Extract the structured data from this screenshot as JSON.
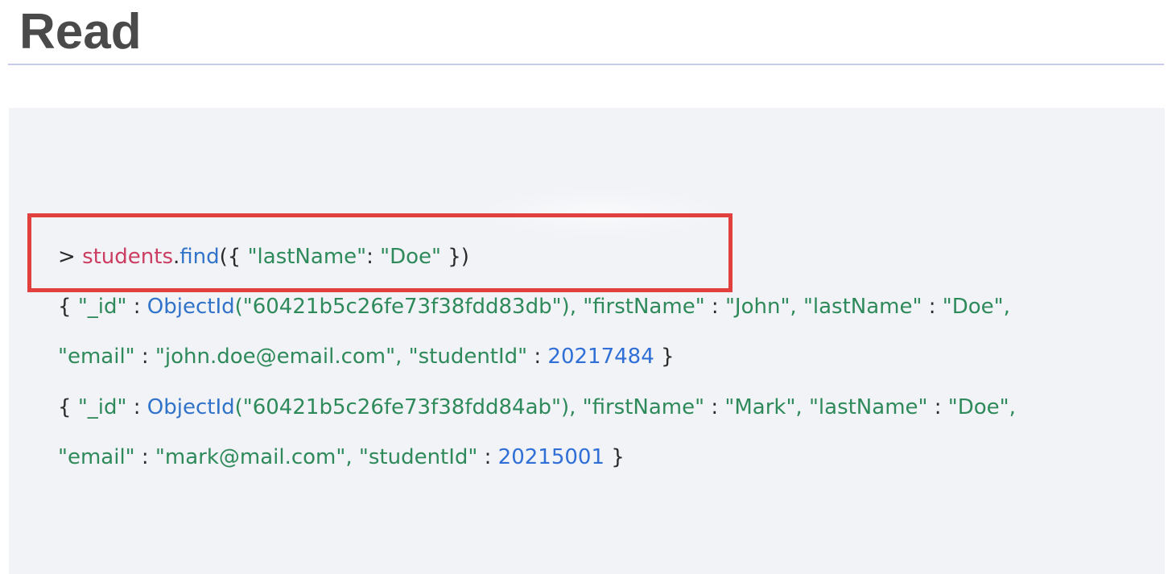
{
  "slide": {
    "title": "Read"
  },
  "command": {
    "prompt": ">",
    "collection": "students",
    "dot": ".",
    "method": "find",
    "open": "({",
    "key": "\"lastName\"",
    "colon": ":",
    "value": "\"Doe\"",
    "close": "})"
  },
  "results": [
    {
      "open": "{",
      "id_key": "\"_id\"",
      "sep": ":",
      "objectid_fn": "ObjectId",
      "objectid_arg": "(\"60421b5c26fe73f38fdd83db\"),",
      "firstname_key": "\"firstName\"",
      "firstname_value": "\"John\",",
      "lastname_key": "\"lastName\"",
      "lastname_value": "\"Doe\",",
      "email_key": "\"email\"",
      "email_value": "\"john.doe@email.com\",",
      "studentid_key": "\"studentId\"",
      "studentid_value": "20217484",
      "close": "}"
    },
    {
      "open": "{",
      "id_key": "\"_id\"",
      "sep": ":",
      "objectid_fn": "ObjectId",
      "objectid_arg": "(\"60421b5c26fe73f38fdd84ab\"),",
      "firstname_key": "\"firstName\"",
      "firstname_value": "\"Mark\",",
      "lastname_key": "\"lastName\"",
      "lastname_value": "\"Doe\",",
      "email_key": "\"email\"",
      "email_value": "\"mark@mail.com\",",
      "studentid_key": "\"studentId\"",
      "studentid_value": "20215001",
      "close": "}"
    }
  ],
  "colors": {
    "title": "#4a4a4a",
    "rule": "#c8cbf0",
    "panel": "#f2f3f7",
    "highlight_border": "#e2403f",
    "collection": "#cc3d62",
    "method": "#3073c9",
    "string": "#2e8a5a",
    "number": "#2f6fd6",
    "plain": "#2b2b2b"
  }
}
